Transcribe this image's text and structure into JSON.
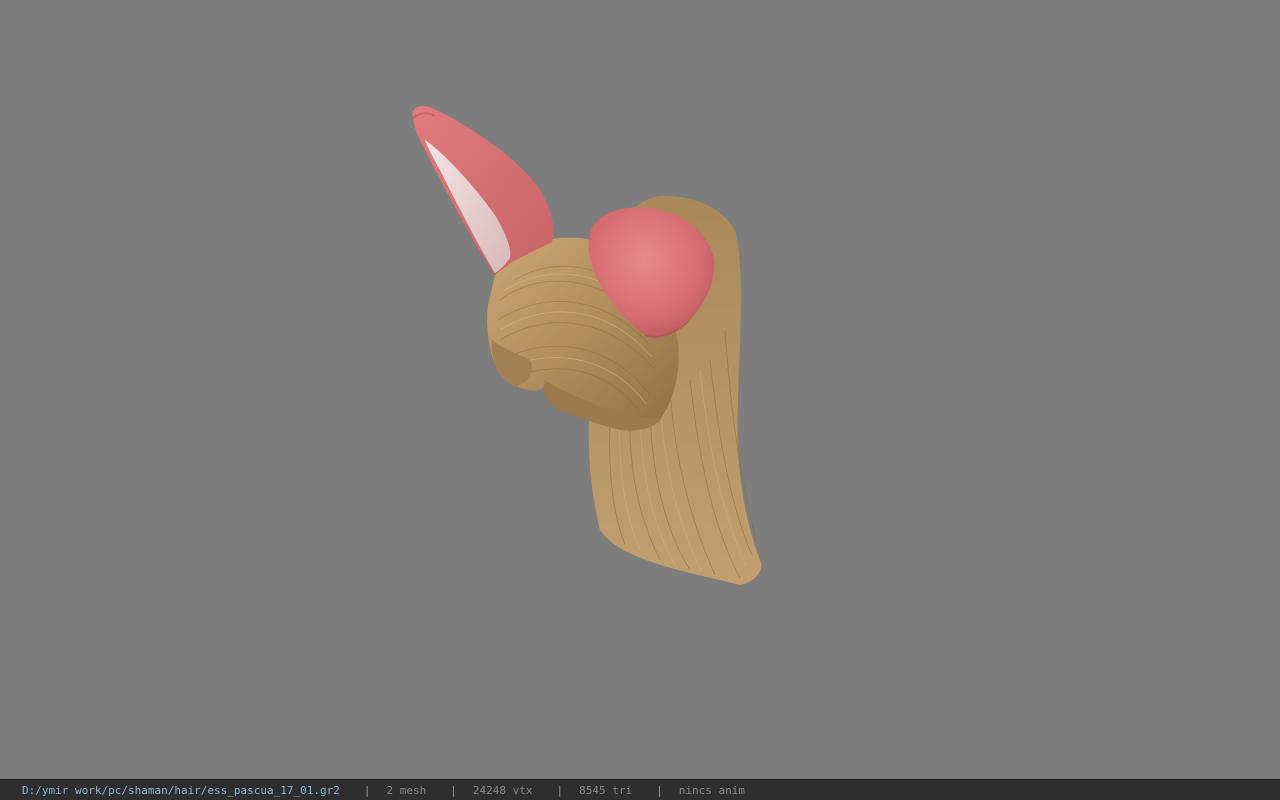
{
  "viewport": {
    "background_color": "#7d7d7d",
    "model": {
      "hair_color": "#b4915f",
      "ear_color": "#d96f72",
      "ear_inner_color": "#ecd9d9"
    }
  },
  "status_bar": {
    "file_path": "D:/ymir work/pc/shaman/hair/ess_pascua_17_01.gr2",
    "separator": "|",
    "mesh_count": "2 mesh",
    "vertex_count": "24248 vtx",
    "triangle_count": "8545 tri",
    "anim_status": "nincs anim",
    "colors": {
      "background": "#2e2e2e",
      "path": "#8fb7cf",
      "stats": "#8a8a8a"
    }
  }
}
